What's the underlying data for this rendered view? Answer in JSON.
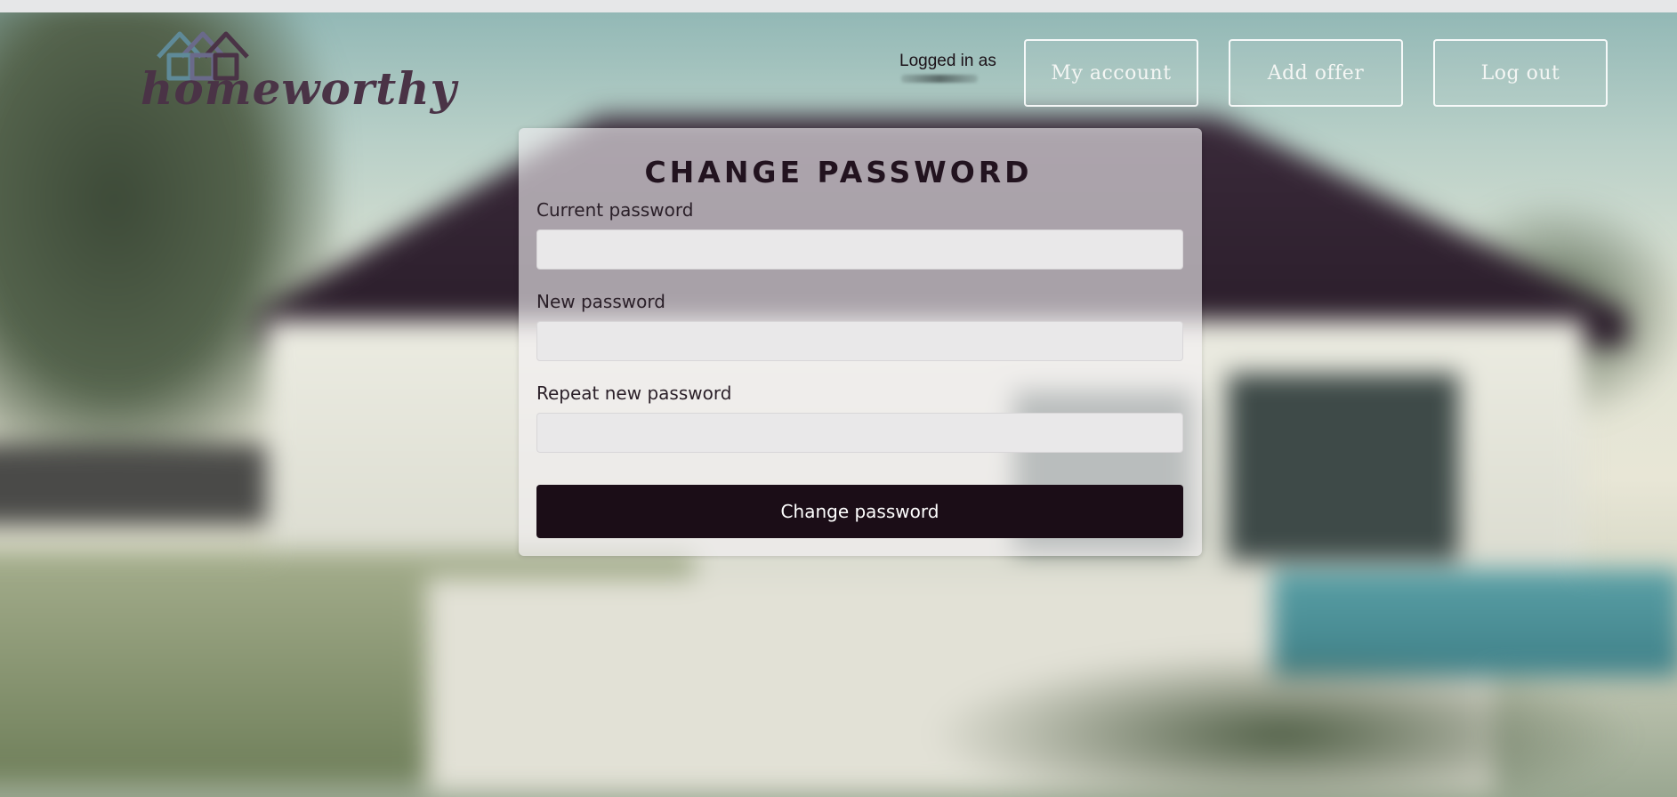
{
  "brand": {
    "name": "homeworthy",
    "logo_color": "#4a3346"
  },
  "header": {
    "logged_in_label": "Logged in as",
    "nav": {
      "my_account": "My account",
      "add_offer": "Add offer",
      "log_out": "Log out"
    }
  },
  "form": {
    "title": "CHANGE PASSWORD",
    "fields": [
      {
        "label": "Current password",
        "value": ""
      },
      {
        "label": "New password",
        "value": ""
      },
      {
        "label": "Repeat new password",
        "value": ""
      }
    ],
    "submit_label": "Change password",
    "submit_color": "#1b0d17"
  },
  "icons": [
    "house-logo-icon"
  ]
}
